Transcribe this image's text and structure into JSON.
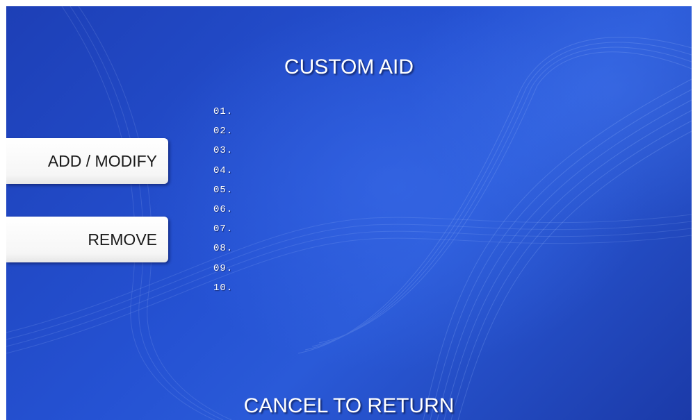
{
  "screen": {
    "title": "CUSTOM AID",
    "footer": "CANCEL TO RETURN"
  },
  "buttons": {
    "add_modify": "ADD / MODIFY",
    "remove": "REMOVE"
  },
  "aid_list": [
    "01.",
    "02.",
    "03.",
    "04.",
    "05.",
    "06.",
    "07.",
    "08.",
    "09.",
    "10."
  ],
  "colors": {
    "background": "#2552d3",
    "text": "#ffffff",
    "button": "#ffffff"
  }
}
